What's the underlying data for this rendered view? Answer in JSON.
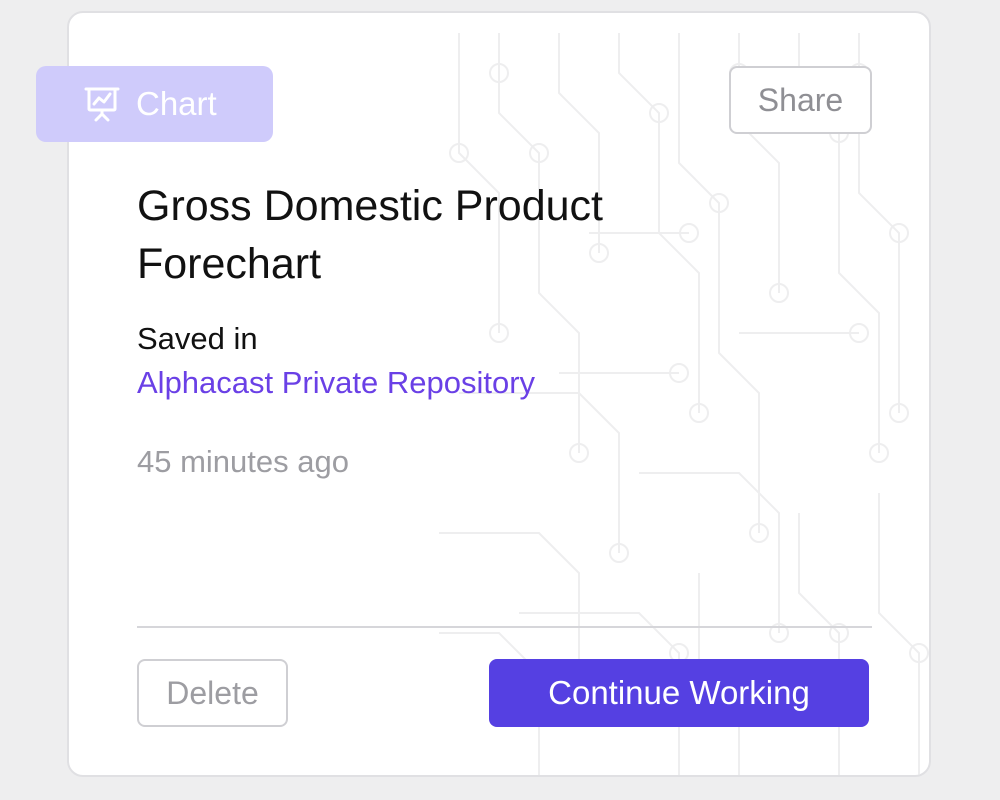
{
  "card": {
    "type_badge": {
      "label": "Chart",
      "icon": "presentation-chart-icon"
    },
    "share_label": "Share",
    "title": "Gross Domestic Product Forechart",
    "saved_in_label": "Saved in",
    "repository": "Alphacast Private Repository",
    "timestamp": "45 minutes ago",
    "delete_label": "Delete",
    "continue_label": "Continue Working"
  },
  "colors": {
    "badge_bg": "#cfcbfb",
    "accent": "#5540e2",
    "link": "#6a40e6",
    "muted_text": "#9d9da2"
  }
}
